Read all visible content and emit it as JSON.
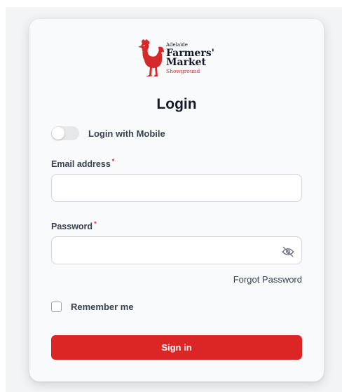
{
  "brand": {
    "line1": "Adelaide",
    "line2": "Farmers'",
    "line3": "Market",
    "line4": "Showground",
    "accent_color": "#dc2626",
    "logo_icon": "rooster-icon"
  },
  "page": {
    "title": "Login"
  },
  "mobile_toggle": {
    "label": "Login with Mobile",
    "checked": false
  },
  "email": {
    "label": "Email address",
    "required_mark": "*",
    "value": "",
    "placeholder": ""
  },
  "password": {
    "label": "Password",
    "required_mark": "*",
    "value": "",
    "placeholder": "",
    "visibility_icon": "eye-off-icon"
  },
  "forgot_password": {
    "label": "Forgot Password"
  },
  "remember_me": {
    "label": "Remember me",
    "checked": false
  },
  "submit": {
    "label": "Sign in"
  }
}
